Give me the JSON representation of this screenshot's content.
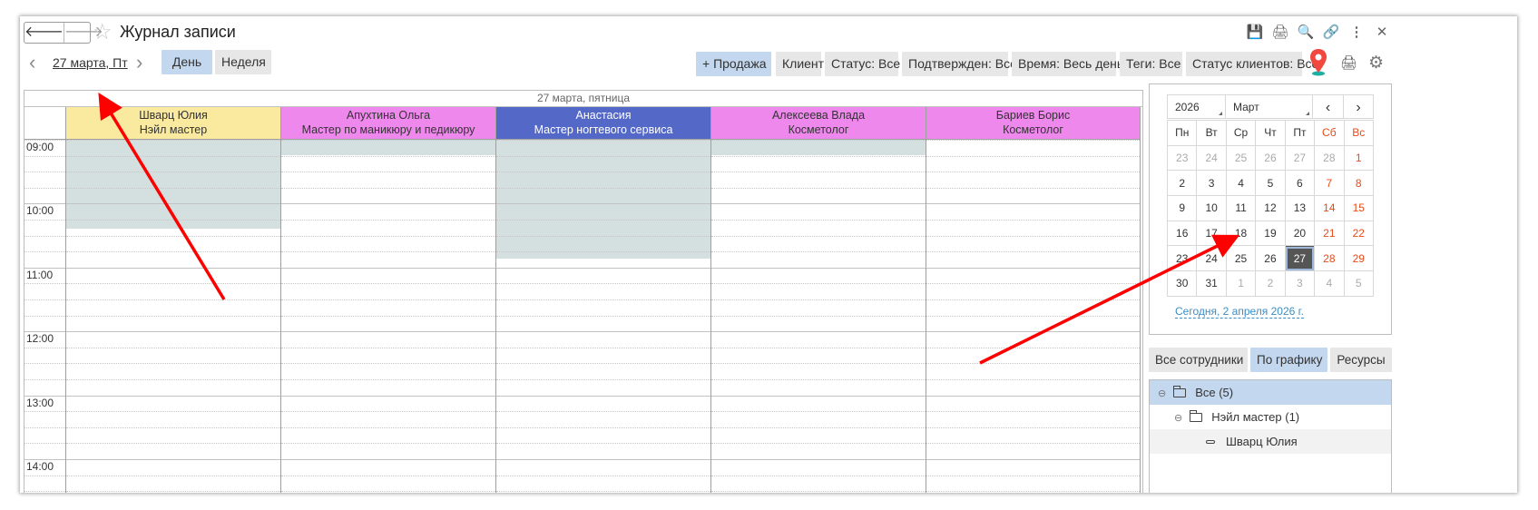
{
  "window": {
    "title": "Журнал записи"
  },
  "toolbar": {
    "date_label": "27 марта, Пт",
    "view_day": "День",
    "view_week": "Неделя",
    "filters": [
      "+ Продажа",
      "Клиент",
      "Статус: Все",
      "Подтвержден: Все",
      "Время: Весь день",
      "Теги: Все",
      "Статус клиентов: Все"
    ]
  },
  "schedule": {
    "date_header": "27 марта, пятница",
    "times": [
      "09:00",
      "10:00",
      "11:00",
      "12:00",
      "13:00",
      "14:00"
    ],
    "columns": [
      {
        "name": "Шварц Юлия",
        "role": "Нэйл мастер",
        "color": "#faeaa0",
        "text_color": "#333333"
      },
      {
        "name": "Апухтина Ольга",
        "role": "Мастер по маникюру и педикюру",
        "color": "#ef88ed",
        "text_color": "#333333"
      },
      {
        "name": "Анастасия",
        "role": "Мастер ногтевого сервиса",
        "color": "#5468c7",
        "text_color": "#ffffff"
      },
      {
        "name": "Алексеева Влада",
        "role": "Косметолог",
        "color": "#ef88ed",
        "text_color": "#333333"
      },
      {
        "name": "Бариев Борис",
        "role": "Косметолог",
        "color": "#ef88ed",
        "text_color": "#333333"
      }
    ]
  },
  "calendar": {
    "year": "2026",
    "month": "Март",
    "weekdays": [
      "Пн",
      "Вт",
      "Ср",
      "Чт",
      "Пт",
      "Сб",
      "Вс"
    ],
    "weeks": [
      [
        "23",
        "24",
        "25",
        "26",
        "27",
        "28",
        "1"
      ],
      [
        "2",
        "3",
        "4",
        "5",
        "6",
        "7",
        "8"
      ],
      [
        "9",
        "10",
        "11",
        "12",
        "13",
        "14",
        "15"
      ],
      [
        "16",
        "17",
        "18",
        "19",
        "20",
        "21",
        "22"
      ],
      [
        "23",
        "24",
        "25",
        "26",
        "27",
        "28",
        "29"
      ],
      [
        "30",
        "31",
        "1",
        "2",
        "3",
        "4",
        "5"
      ]
    ],
    "selected_day": "27",
    "today_link": "Сегодня, 2 апреля 2026 г.",
    "weekend_color": "#e64b19"
  },
  "staff_tabs": [
    "Все сотрудники",
    "По графику",
    "Ресурсы"
  ],
  "tree": [
    {
      "label": "Все (5)",
      "level": 0,
      "type": "folder"
    },
    {
      "label": "Нэйл мастер  (1)",
      "level": 1,
      "type": "folder"
    },
    {
      "label": "Шварц Юлия",
      "level": 2,
      "type": "item"
    }
  ]
}
